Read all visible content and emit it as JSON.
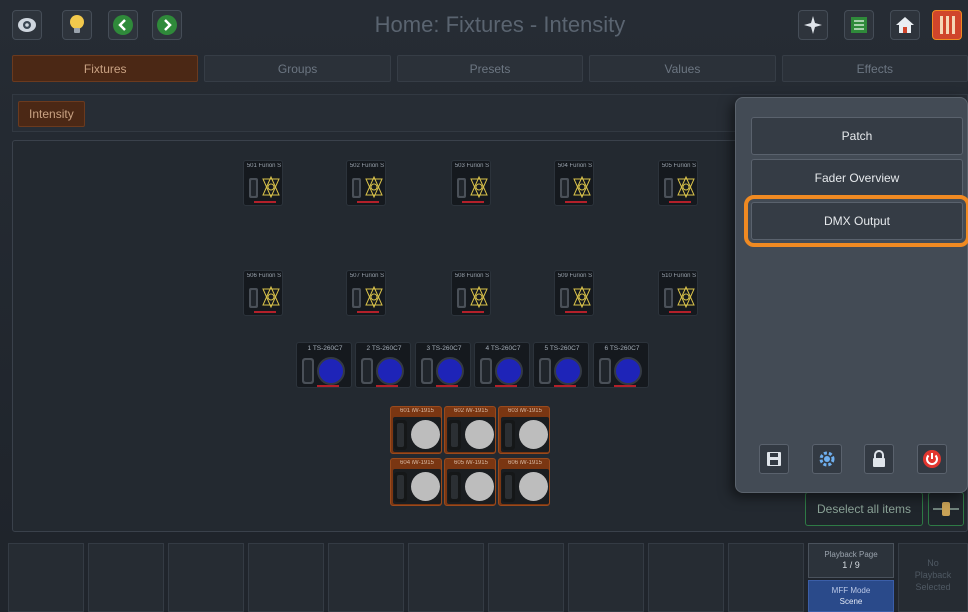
{
  "header": {
    "title": "Home: Fixtures - Intensity",
    "accent_color": "#f08a22"
  },
  "tabs": [
    {
      "label": "Fixtures",
      "active": true
    },
    {
      "label": "Groups",
      "active": false
    },
    {
      "label": "Presets",
      "active": false
    },
    {
      "label": "Values",
      "active": false
    },
    {
      "label": "Effects",
      "active": false
    }
  ],
  "subbar": {
    "chip_label": "Intensity"
  },
  "fixtures": {
    "row1": [
      "501 Furion S",
      "502 Furion S",
      "503 Furion S",
      "504 Furion S",
      "505 Furion S"
    ],
    "row2": [
      "506 Furion S",
      "507 Furion S",
      "508 Furion S",
      "509 Furion S",
      "510 Furion S"
    ],
    "row3": [
      "1 TS-260C7",
      "2 TS-260C7",
      "3 TS-260C7",
      "4 TS-260C7",
      "5 TS-260C7",
      "6 TS-260C7"
    ],
    "row4": [
      "601 iW-1915",
      "602 iW-1915",
      "603 iW-1915"
    ],
    "row5": [
      "604 iW-1915",
      "605 iW-1915",
      "606 iW-1915"
    ]
  },
  "panel": {
    "buttons": [
      "Patch",
      "Fader Overview",
      "DMX Output"
    ],
    "highlighted": "DMX Output",
    "icons": [
      "save-icon",
      "gear-icon",
      "lock-icon",
      "power-icon"
    ]
  },
  "deselect_label": "Deselect all items",
  "playback": {
    "page_label": "Playback Page",
    "page_value": "1 / 9",
    "mff_label": "MFF Mode",
    "mff_value": "Scene",
    "no_playback_line1": "No",
    "no_playback_line2": "Playback",
    "no_playback_line3": "Selected"
  }
}
